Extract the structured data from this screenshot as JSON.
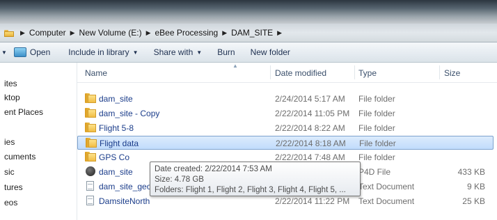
{
  "address": {
    "crumbs": [
      "Computer",
      "New Volume (E:)",
      "eBee Processing",
      "DAM_SITE"
    ]
  },
  "toolbar": {
    "open_label": "Open",
    "include_label": "Include in library",
    "share_label": "Share with",
    "burn_label": "Burn",
    "new_folder_label": "New folder"
  },
  "nav": {
    "items": [
      "ites",
      "ktop",
      "ent Places",
      "ies",
      "cuments",
      "sic",
      "tures",
      "eos"
    ]
  },
  "columns": {
    "name": "Name",
    "date": "Date modified",
    "type": "Type",
    "size": "Size"
  },
  "files": [
    {
      "name": "dam_site",
      "date": "2/24/2014 5:17 AM",
      "type": "File folder",
      "size": "",
      "icon": "folder-icon"
    },
    {
      "name": "dam_site - Copy",
      "date": "2/22/2014 11:05 PM",
      "type": "File folder",
      "size": "",
      "icon": "folder-icon"
    },
    {
      "name": "Flight 5-8",
      "date": "2/22/2014 8:22 AM",
      "type": "File folder",
      "size": "",
      "icon": "folder-icon"
    },
    {
      "name": "Flight data",
      "date": "2/22/2014 8:18 AM",
      "type": "File folder",
      "size": "",
      "icon": "folder-icon"
    },
    {
      "name": "GPS Co",
      "date": "2/22/2014 7:48 AM",
      "type": "File folder",
      "size": "",
      "icon": "folder-icon"
    },
    {
      "name": "dam_site",
      "date": "",
      "type": "P4D File",
      "size": "433 KB",
      "icon": "pix4d-icon"
    },
    {
      "name": "dam_site_geo",
      "date": "",
      "type": "Text Document",
      "size": "9 KB",
      "icon": "text-document-icon"
    },
    {
      "name": "DamsiteNorth",
      "date": "2/22/2014 11:22 PM",
      "type": "Text Document",
      "size": "25 KB",
      "icon": "text-document-icon"
    }
  ],
  "tooltip": {
    "line1": "Date created: 2/22/2014 7:53 AM",
    "line2": "Size: 4.78 GB",
    "line3": "Folders: Flight 1, Flight 2, Flight 3, Flight 4, Flight 5, ..."
  }
}
